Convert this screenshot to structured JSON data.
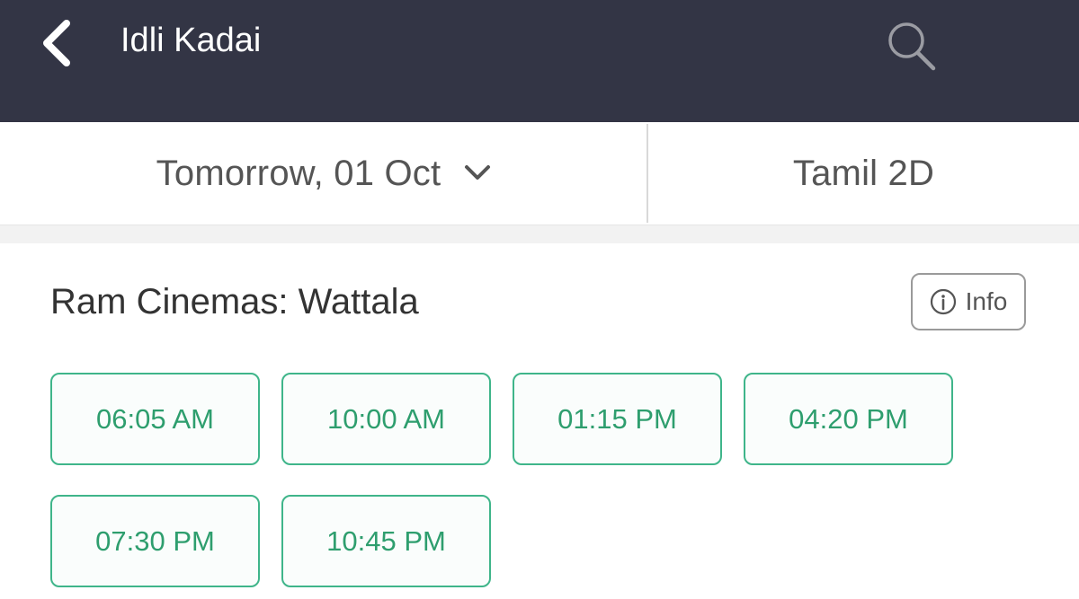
{
  "header": {
    "title": "Idli Kadai",
    "icons": {
      "back": "chevron-left-icon",
      "search": "search-icon"
    }
  },
  "filters": {
    "date_label": "Tomorrow, 01 Oct",
    "format_label": "Tamil 2D",
    "icons": {
      "date_dropdown": "chevron-down-icon"
    }
  },
  "cinema": {
    "name": "Ram Cinemas: Wattala",
    "info_label": "Info",
    "showtimes": [
      {
        "time": "06:05 AM"
      },
      {
        "time": "10:00 AM"
      },
      {
        "time": "01:15 PM"
      },
      {
        "time": "04:20 PM"
      },
      {
        "time": "07:30 PM"
      },
      {
        "time": "10:45 PM"
      }
    ]
  },
  "colors": {
    "header_bg": "#333545",
    "showtime_accent": "#3fb58a",
    "showtime_text": "#2e9e6e"
  }
}
